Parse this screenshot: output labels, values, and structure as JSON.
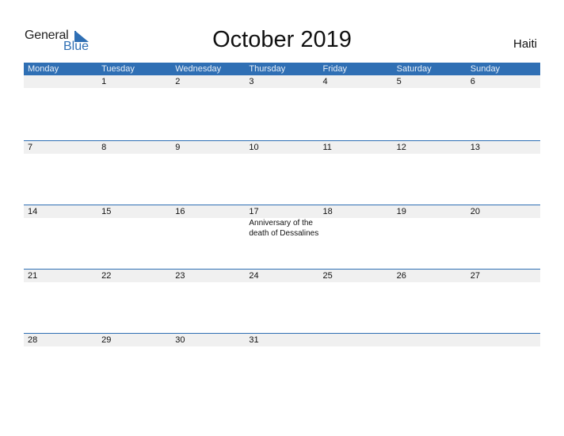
{
  "logo": {
    "general": "General",
    "blue": "Blue"
  },
  "header": {
    "title": "October 2019",
    "country": "Haiti"
  },
  "colors": {
    "accent": "#2f6fb4",
    "date_strip": "#f0f0f0"
  },
  "weekdays": [
    "Monday",
    "Tuesday",
    "Wednesday",
    "Thursday",
    "Friday",
    "Saturday",
    "Sunday"
  ],
  "weeks": [
    {
      "days": [
        "",
        "1",
        "2",
        "3",
        "4",
        "5",
        "6"
      ],
      "events": [
        "",
        "",
        "",
        "",
        "",
        "",
        ""
      ]
    },
    {
      "days": [
        "7",
        "8",
        "9",
        "10",
        "11",
        "12",
        "13"
      ],
      "events": [
        "",
        "",
        "",
        "",
        "",
        "",
        ""
      ]
    },
    {
      "days": [
        "14",
        "15",
        "16",
        "17",
        "18",
        "19",
        "20"
      ],
      "events": [
        "",
        "",
        "",
        "Anniversary of the death of Dessalines",
        "",
        "",
        ""
      ]
    },
    {
      "days": [
        "21",
        "22",
        "23",
        "24",
        "25",
        "26",
        "27"
      ],
      "events": [
        "",
        "",
        "",
        "",
        "",
        "",
        ""
      ]
    },
    {
      "days": [
        "28",
        "29",
        "30",
        "31",
        "",
        "",
        ""
      ],
      "events": [
        "",
        "",
        "",
        "",
        "",
        "",
        ""
      ]
    }
  ]
}
